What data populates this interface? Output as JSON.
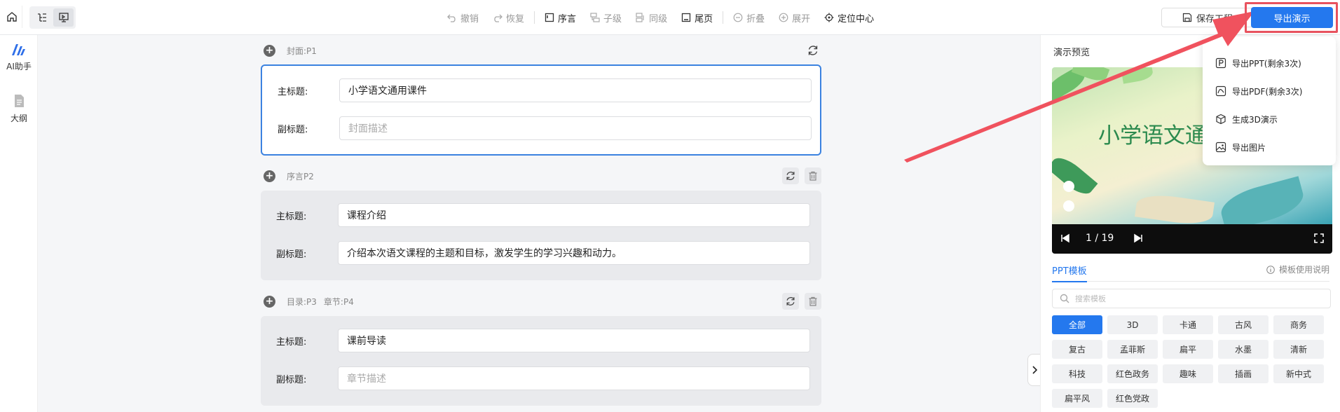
{
  "topbar": {
    "toolbar": [
      {
        "label": "撤销",
        "icon": "undo-icon",
        "enabled": false
      },
      {
        "label": "恢复",
        "icon": "redo-icon",
        "enabled": false
      },
      {
        "label": "序言",
        "icon": "preface-icon",
        "enabled": true
      },
      {
        "label": "子级",
        "icon": "child-level-icon",
        "enabled": false
      },
      {
        "label": "同级",
        "icon": "sibling-level-icon",
        "enabled": false
      },
      {
        "label": "尾页",
        "icon": "last-page-icon",
        "enabled": true
      },
      {
        "label": "折叠",
        "icon": "collapse-icon",
        "enabled": false
      },
      {
        "label": "展开",
        "icon": "expand-icon",
        "enabled": false
      },
      {
        "label": "定位中心",
        "icon": "locate-center-icon",
        "enabled": true
      }
    ],
    "save_label": "保存工程",
    "export_label": "导出演示"
  },
  "leftnav": {
    "ai_label": "AI助手",
    "outline_label": "大纲"
  },
  "sections": [
    {
      "labels": [
        "封面:P1"
      ],
      "main_label": "主标题:",
      "main_value": "小学语文通用课件",
      "sub_label": "副标题:",
      "sub_value": "",
      "sub_placeholder": "封面描述"
    },
    {
      "labels": [
        "序言P2"
      ],
      "main_label": "主标题:",
      "main_value": "课程介绍",
      "sub_label": "副标题:",
      "sub_value": "介绍本次语文课程的主题和目标，激发学生的学习兴趣和动力。",
      "sub_placeholder": ""
    },
    {
      "labels": [
        "目录:P3",
        "章节:P4"
      ],
      "main_label": "主标题:",
      "main_value": "课前导读",
      "sub_label": "副标题:",
      "sub_value": "",
      "sub_placeholder": "章节描述"
    }
  ],
  "preview": {
    "title": "演示预览",
    "slide_title": "小学语文通",
    "counter": "1 / 19"
  },
  "templates": {
    "tab_label": "PPT模板",
    "help_label": "模板使用说明",
    "search_placeholder": "搜索模板",
    "tags": [
      "全部",
      "3D",
      "卡通",
      "古风",
      "商务",
      "复古",
      "孟菲斯",
      "扁平",
      "水墨",
      "清新",
      "科技",
      "红色政务",
      "趣味",
      "插画",
      "新中式",
      "扁平风",
      "红色党政"
    ],
    "active_tag": "全部"
  },
  "export_menu": [
    {
      "label": "导出PPT(剩余3次)",
      "icon": "ppt-icon"
    },
    {
      "label": "导出PDF(剩余3次)",
      "icon": "pdf-icon"
    },
    {
      "label": "生成3D演示",
      "icon": "cube-icon"
    },
    {
      "label": "导出图片",
      "icon": "image-icon"
    }
  ],
  "colors": {
    "accent": "#2478ee",
    "highlight": "#e8535f"
  }
}
